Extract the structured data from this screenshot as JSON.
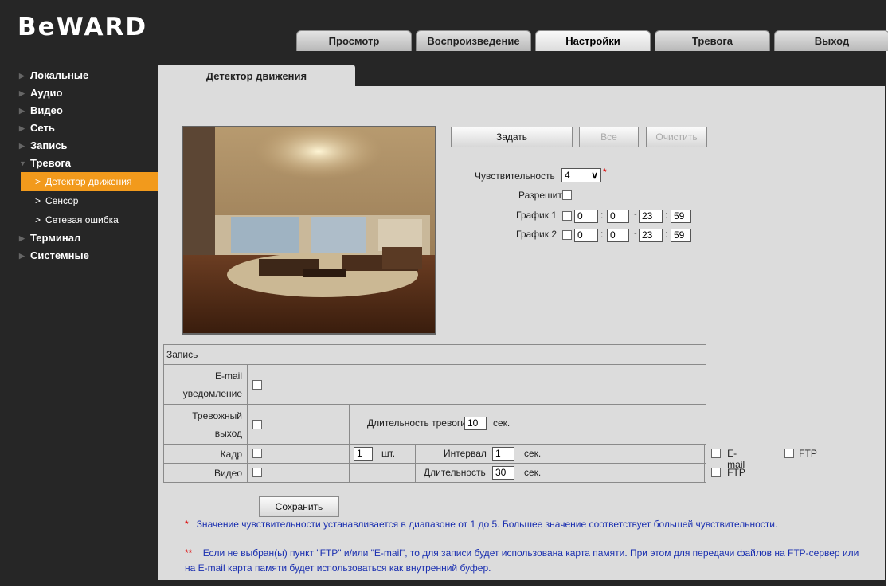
{
  "brand": {
    "logo_text": "BeWARD"
  },
  "tabs": [
    {
      "label": "Просмотр"
    },
    {
      "label": "Воспроизведение"
    },
    {
      "label": "Настройки",
      "active": true
    },
    {
      "label": "Тревога"
    },
    {
      "label": "Выход"
    }
  ],
  "sidebar": {
    "items": [
      {
        "label": "Локальные"
      },
      {
        "label": "Аудио"
      },
      {
        "label": "Видео"
      },
      {
        "label": "Сеть"
      },
      {
        "label": "Запись"
      },
      {
        "label": "Тревога",
        "expanded": true
      },
      {
        "label": "Детектор движения",
        "sub": true,
        "active": true
      },
      {
        "label": "Сенсор",
        "sub": true
      },
      {
        "label": "Сетевая ошибка",
        "sub": true
      },
      {
        "label": "Терминал"
      },
      {
        "label": "Системные"
      }
    ]
  },
  "page": {
    "tab_title": "Детектор движения"
  },
  "controls": {
    "set_label": "Задать",
    "all_label": "Все",
    "clear_label": "Очистить",
    "sensitivity_label": "Чувствительность",
    "sensitivity_value": "4",
    "sensitivity_star": "*",
    "enable_label": "Разрешить",
    "schedule1_label": "График 1",
    "schedule2_label": "График 2",
    "schedule1": {
      "h1": "0",
      "m1": "0",
      "h2": "23",
      "m2": "59"
    },
    "schedule2": {
      "h1": "0",
      "m1": "0",
      "h2": "23",
      "m2": "59"
    },
    "colon": ":",
    "dash": "~"
  },
  "record": {
    "header": "Запись",
    "email_label_1": "E-mail",
    "email_label_2": "уведомление",
    "alarm_out_label_1": "Тревожный",
    "alarm_out_label_2": "выход",
    "alarm_duration_label": "Длительность тревоги",
    "alarm_duration_value": "10",
    "sec": "сек.",
    "frame_label": "Кадр",
    "frame_count": "1",
    "pcs": "шт.",
    "interval_label": "Интервал",
    "interval_value": "1",
    "email_opt": "E-mail",
    "ftp_opt": "FTP",
    "video_label": "Видео",
    "video_duration_label": "Длительность",
    "video_duration_value": "30"
  },
  "save_label": "Сохранить",
  "notes": {
    "note1_star": "*",
    "note1": "Значение чувствительности устанавливается в диапазоне от 1 до 5. Большее значение соответствует большей чувствительности.",
    "note2_star": "**",
    "note2_line1": "Если не выбран(ы) пункт \"FTP\" и/или \"E-mail\", то для записи будет использована карта памяти. При этом для передачи файлов на FTP-сервер или",
    "note2_line2": "на E-mail карта памяти будет использоваться как внутренний буфер."
  }
}
